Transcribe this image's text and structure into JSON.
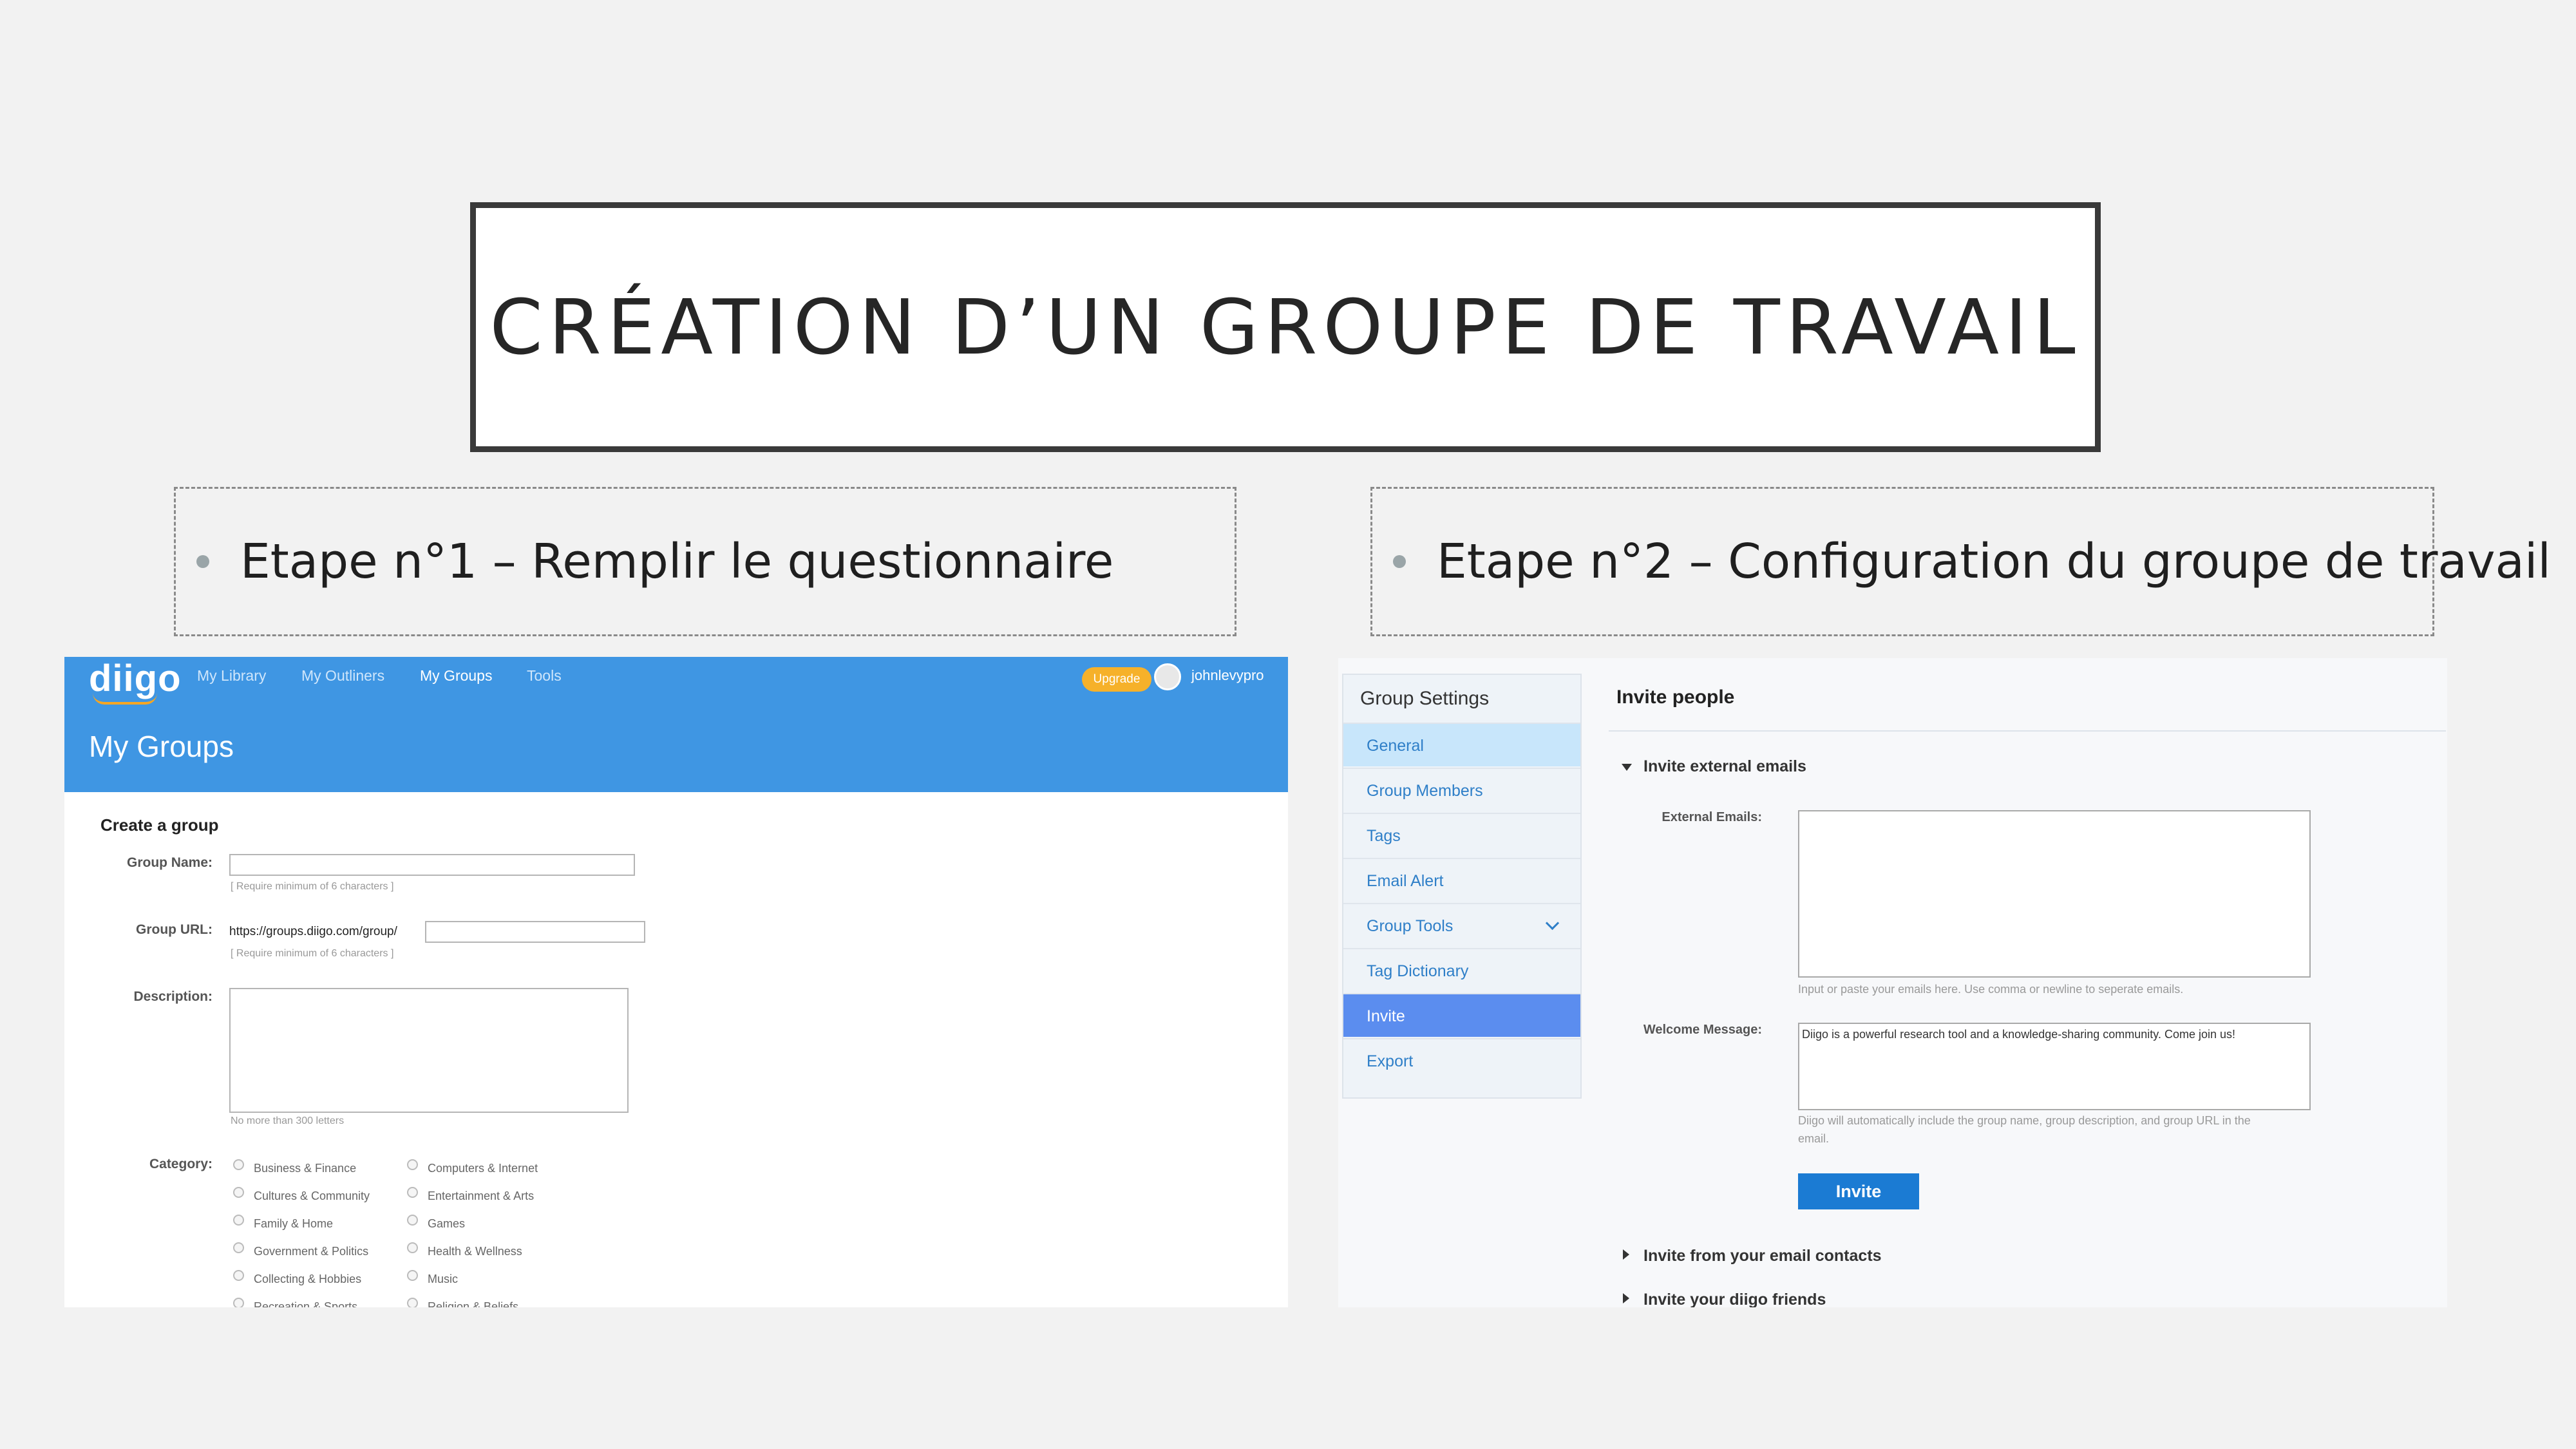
{
  "slide": {
    "title": "CRÉATION D’UN GROUPE DE TRAVAIL",
    "step1": "Etape n°1 – Remplir le questionnaire",
    "step2": "Etape n°2 – Configuration du groupe de travail"
  },
  "diigo": {
    "logo": "diigo",
    "nav": [
      "My Library",
      "My Outliners",
      "My Groups",
      "Tools"
    ],
    "active_nav": "My Groups",
    "upgrade": "Upgrade",
    "username": "johnlevypro",
    "page_title": "My Groups",
    "form_title": "Create a group",
    "group_name_label": "Group Name:",
    "group_name_hint": "[ Require minimum of 6 characters ]",
    "group_url_label": "Group URL:",
    "group_url_prefix": "https://groups.diigo.com/group/",
    "group_url_hint": "[ Require minimum of 6 characters ]",
    "description_label": "Description:",
    "description_hint": "No more than 300 letters",
    "category_label": "Category:",
    "categories_col1": [
      "Business & Finance",
      "Cultures & Community",
      "Family & Home",
      "Government & Politics",
      "Collecting & Hobbies",
      "Recreation & Sports"
    ],
    "categories_col2": [
      "Computers & Internet",
      "Entertainment & Arts",
      "Games",
      "Health & Wellness",
      "Music",
      "Religion & Beliefs"
    ]
  },
  "settings": {
    "sidebar_title": "Group Settings",
    "items": [
      "General",
      "Group Members",
      "Tags",
      "Email Alert",
      "Group Tools",
      "Tag Dictionary",
      "Invite",
      "Export"
    ],
    "selected_item": "General",
    "active_item": "Invite",
    "main_title": "Invite people",
    "section_external": "Invite external emails",
    "external_label": "External Emails:",
    "external_hint": "Input or paste your emails here. Use comma or newline to seperate emails.",
    "welcome_label": "Welcome Message:",
    "welcome_value": "Diigo is a powerful research tool and a knowledge-sharing community. Come join us!",
    "welcome_hint_line1": "Diigo will automatically include the group name, group description, and group URL in the",
    "welcome_hint_line2": "email.",
    "invite_button": "Invite",
    "section_contacts": "Invite from your email contacts",
    "section_friends": "Invite your diigo friends"
  }
}
